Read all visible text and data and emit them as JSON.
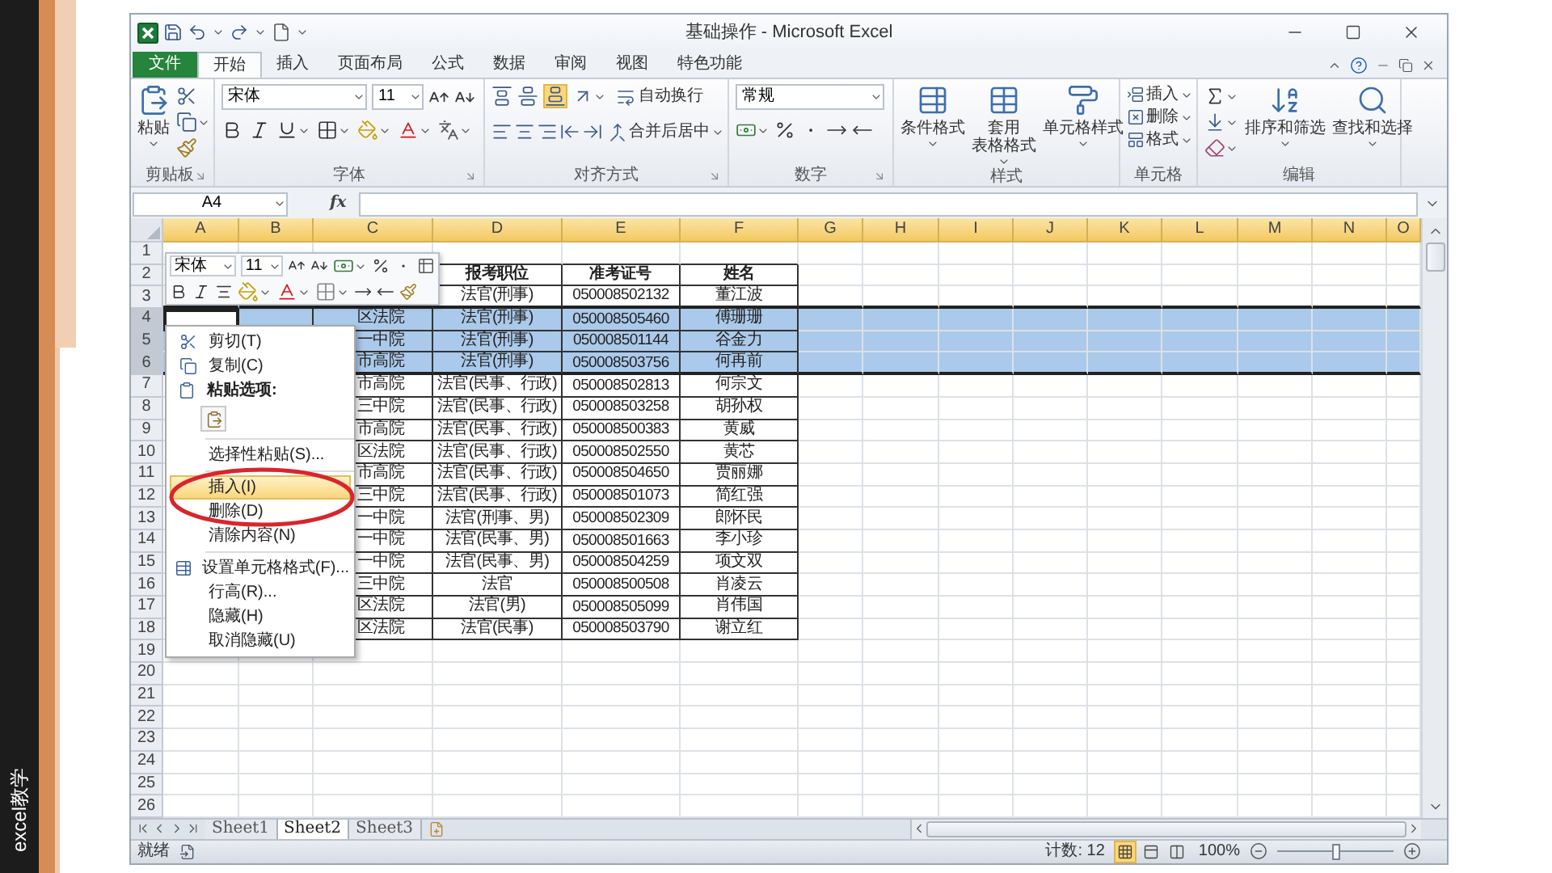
{
  "sidebar": {
    "caption": "excel教学"
  },
  "window": {
    "title": "基础操作 - Microsoft Excel"
  },
  "ribbon_tabs": [
    {
      "label": "文件",
      "kind": "file",
      "selected": false
    },
    {
      "label": "开始",
      "kind": "tab",
      "selected": true
    },
    {
      "label": "插入",
      "kind": "tab",
      "selected": false
    },
    {
      "label": "页面布局",
      "kind": "tab",
      "selected": false
    },
    {
      "label": "公式",
      "kind": "tab",
      "selected": false
    },
    {
      "label": "数据",
      "kind": "tab",
      "selected": false
    },
    {
      "label": "审阅",
      "kind": "tab",
      "selected": false
    },
    {
      "label": "视图",
      "kind": "tab",
      "selected": false
    },
    {
      "label": "特色功能",
      "kind": "tab",
      "selected": false
    }
  ],
  "ribbon": {
    "clipboard": {
      "label": "剪贴板",
      "paste": "粘贴"
    },
    "font": {
      "label": "字体",
      "font_name": "宋体",
      "font_size": "11"
    },
    "alignment": {
      "label": "对齐方式",
      "wrap_text": "自动换行",
      "merge_center": "合并后居中"
    },
    "number": {
      "label": "数字",
      "format": "常规"
    },
    "styles": {
      "label": "样式",
      "buttons": [
        {
          "lines": [
            "条件格式"
          ]
        },
        {
          "lines": [
            "套用",
            "表格格式"
          ]
        },
        {
          "lines": [
            "单元格样式"
          ]
        }
      ]
    },
    "cells": {
      "label": "单元格",
      "buttons": [
        "插入",
        "删除",
        "格式"
      ]
    },
    "editing": {
      "label": "编辑",
      "buttons": [
        "排序和筛选",
        "查找和选择"
      ]
    }
  },
  "formula_bar": {
    "name_box": "A4",
    "function_label": "fx"
  },
  "sheet": {
    "columns": [
      "A",
      "B",
      "C",
      "D",
      "E",
      "F",
      "G",
      "H",
      "I",
      "J",
      "K",
      "L",
      "M",
      "N",
      "O"
    ],
    "rows": [
      {
        "number": "1",
        "kind": "empty",
        "selected": false,
        "active": false
      },
      {
        "number": "2",
        "kind": "header",
        "selected": false,
        "active": false,
        "d": "报考职位",
        "e": "准考证号",
        "f": "姓名"
      },
      {
        "number": "3",
        "kind": "data",
        "selected": false,
        "active": false,
        "d": "法官(刑事)",
        "e": "050008502132",
        "f": "董江波"
      },
      {
        "number": "4",
        "kind": "data",
        "selected": true,
        "active": true,
        "c": "区法院",
        "d": "法官(刑事)",
        "e": "050008505460",
        "f": "傅珊珊"
      },
      {
        "number": "5",
        "kind": "data",
        "selected": true,
        "active": false,
        "c": "一中院",
        "d": "法官(刑事)",
        "e": "050008501144",
        "f": "谷金力"
      },
      {
        "number": "6",
        "kind": "data",
        "selected": true,
        "active": false,
        "c": "市高院",
        "d": "法官(刑事)",
        "e": "050008503756",
        "f": "何再前"
      },
      {
        "number": "7",
        "kind": "data",
        "selected": false,
        "active": false,
        "c": "市高院",
        "d": "法官(民事、行政)",
        "e": "050008502813",
        "f": "何宗文"
      },
      {
        "number": "8",
        "kind": "data",
        "selected": false,
        "active": false,
        "c": "三中院",
        "d": "法官(民事、行政)",
        "e": "050008503258",
        "f": "胡孙权"
      },
      {
        "number": "9",
        "kind": "data",
        "selected": false,
        "active": false,
        "c": "市高院",
        "d": "法官(民事、行政)",
        "e": "050008500383",
        "f": "黄威"
      },
      {
        "number": "10",
        "kind": "data",
        "selected": false,
        "active": false,
        "c": "区法院",
        "d": "法官(民事、行政)",
        "e": "050008502550",
        "f": "黄芯"
      },
      {
        "number": "11",
        "kind": "data",
        "selected": false,
        "active": false,
        "c": "市高院",
        "d": "法官(民事、行政)",
        "e": "050008504650",
        "f": "贾丽娜"
      },
      {
        "number": "12",
        "kind": "data",
        "selected": false,
        "active": false,
        "c": "三中院",
        "d": "法官(民事、行政)",
        "e": "050008501073",
        "f": "简红强"
      },
      {
        "number": "13",
        "kind": "data",
        "selected": false,
        "active": false,
        "c": "一中院",
        "d": "法官(刑事、男)",
        "e": "050008502309",
        "f": "郎怀民"
      },
      {
        "number": "14",
        "kind": "data",
        "selected": false,
        "active": false,
        "c": "一中院",
        "d": "法官(民事、男)",
        "e": "050008501663",
        "f": "李小珍"
      },
      {
        "number": "15",
        "kind": "data",
        "selected": false,
        "active": false,
        "c": "一中院",
        "d": "法官(民事、男)",
        "e": "050008504259",
        "f": "项文双"
      },
      {
        "number": "16",
        "kind": "data",
        "selected": false,
        "active": false,
        "c": "三中院",
        "d": "法官",
        "e": "050008500508",
        "f": "肖凌云"
      },
      {
        "number": "17",
        "kind": "data",
        "selected": false,
        "active": false,
        "c": "区法院",
        "d": "法官(男)",
        "e": "050008505099",
        "f": "肖伟国"
      },
      {
        "number": "18",
        "kind": "data",
        "selected": false,
        "active": false,
        "c": "区法院",
        "d": "法官(民事)",
        "e": "050008503790",
        "f": "谢立红"
      },
      {
        "number": "19",
        "kind": "empty",
        "selected": false,
        "active": false
      },
      {
        "number": "20",
        "kind": "empty",
        "selected": false,
        "active": false
      },
      {
        "number": "21",
        "kind": "empty",
        "selected": false,
        "active": false
      },
      {
        "number": "22",
        "kind": "empty",
        "selected": false,
        "active": false
      },
      {
        "number": "23",
        "kind": "empty",
        "selected": false,
        "active": false
      },
      {
        "number": "24",
        "kind": "empty",
        "selected": false,
        "active": false
      },
      {
        "number": "25",
        "kind": "empty",
        "selected": false,
        "active": false
      },
      {
        "number": "26",
        "kind": "empty",
        "selected": false,
        "active": false
      }
    ]
  },
  "mini_toolbar": {
    "font_name": "宋体",
    "font_size": "11"
  },
  "context_menu": {
    "items": [
      {
        "kind": "command",
        "label": "剪切(T)",
        "selected": false
      },
      {
        "kind": "command",
        "label": "复制(C)",
        "selected": false
      },
      {
        "kind": "heading",
        "label": "粘贴选项:"
      },
      {
        "kind": "paste_options"
      },
      {
        "kind": "separator"
      },
      {
        "kind": "command",
        "label": "选择性粘贴(S)...",
        "selected": false
      },
      {
        "kind": "separator"
      },
      {
        "kind": "command",
        "label": "插入(I)",
        "selected": true
      },
      {
        "kind": "command",
        "label": "删除(D)",
        "selected": false
      },
      {
        "kind": "command",
        "label": "清除内容(N)",
        "selected": false
      },
      {
        "kind": "separator"
      },
      {
        "kind": "command",
        "label": "设置单元格格式(F)...",
        "selected": false
      },
      {
        "kind": "command",
        "label": "行高(R)...",
        "selected": false
      },
      {
        "kind": "command",
        "label": "隐藏(H)",
        "selected": false
      },
      {
        "kind": "command",
        "label": "取消隐藏(U)",
        "selected": false
      }
    ]
  },
  "annotations": [
    {
      "kind": "ellipse"
    }
  ],
  "sheet_tabs": [
    {
      "label": "Sheet1",
      "selected": false
    },
    {
      "label": "Sheet2",
      "selected": true
    },
    {
      "label": "Sheet3",
      "selected": false
    }
  ],
  "status_bar": {
    "mode": "就绪",
    "count": "计数: 12",
    "views": [
      {
        "kind": "normal",
        "selected": true
      },
      {
        "kind": "page_layout",
        "selected": false
      },
      {
        "kind": "page_break",
        "selected": false
      }
    ],
    "zoom": "100%",
    "zoom_slider": {
      "level": 0.5
    }
  }
}
